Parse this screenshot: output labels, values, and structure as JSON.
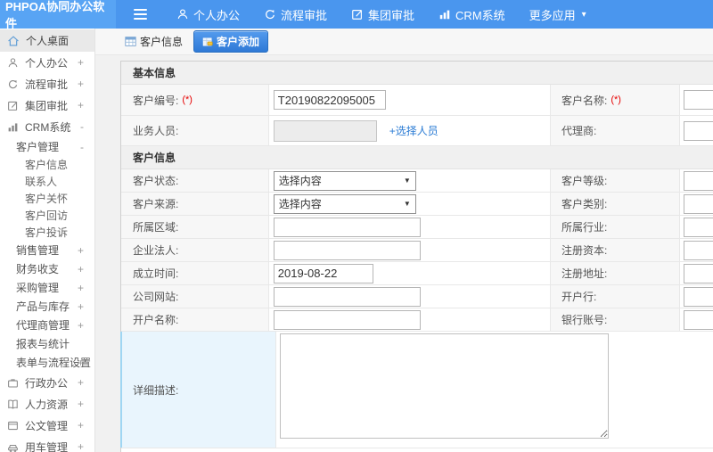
{
  "app": {
    "title": "PHPOA协同办公软件"
  },
  "topnav": {
    "items": [
      {
        "label": "个人办公",
        "icon": "person-icon"
      },
      {
        "label": "流程审批",
        "icon": "process-icon"
      },
      {
        "label": "集团审批",
        "icon": "edit-icon"
      },
      {
        "label": "CRM系统",
        "icon": "chart-icon"
      },
      {
        "label": "更多应用",
        "icon": "caret-down-icon"
      }
    ],
    "caret": "▾"
  },
  "sidebar": {
    "items": [
      {
        "label": "个人桌面",
        "expand": ""
      },
      {
        "label": "个人办公",
        "expand": "+"
      },
      {
        "label": "流程审批",
        "expand": "+"
      },
      {
        "label": "集团审批",
        "expand": "+"
      },
      {
        "label": "CRM系统",
        "expand": "-"
      },
      {
        "label": "客户管理",
        "expand": "-"
      },
      {
        "label": "客户信息",
        "expand": ""
      },
      {
        "label": "联系人",
        "expand": ""
      },
      {
        "label": "客户关怀",
        "expand": ""
      },
      {
        "label": "客户回访",
        "expand": ""
      },
      {
        "label": "客户投诉",
        "expand": ""
      },
      {
        "label": "销售管理",
        "expand": "+"
      },
      {
        "label": "财务收支",
        "expand": "+"
      },
      {
        "label": "采购管理",
        "expand": "+"
      },
      {
        "label": "产品与库存",
        "expand": "+"
      },
      {
        "label": "代理商管理",
        "expand": "+"
      },
      {
        "label": "报表与统计",
        "expand": ""
      },
      {
        "label": "表单与流程设置",
        "expand": "+"
      },
      {
        "label": "行政办公",
        "expand": "+"
      },
      {
        "label": "人力资源",
        "expand": "+"
      },
      {
        "label": "公文管理",
        "expand": "+"
      },
      {
        "label": "用车管理",
        "expand": "+"
      }
    ]
  },
  "tabs": {
    "customer_info": "客户信息",
    "customer_add": "客户添加"
  },
  "form": {
    "section_basic": "基本信息",
    "section_customer": "客户信息",
    "rows": [
      {
        "l1": "客户编号:",
        "req1": "(*)",
        "value": "T20190822095005",
        "l2": "客户名称:",
        "req2": "(*)"
      },
      {
        "l1": "业务人员:",
        "link": "+选择人员",
        "l2": "代理商:"
      },
      {
        "l1": "客户状态:",
        "select": "选择内容",
        "arrow": "▼",
        "l2": "客户等级:"
      },
      {
        "l1": "客户来源:",
        "select": "选择内容",
        "arrow": "▼",
        "l2": "客户类别:"
      },
      {
        "l1": "所属区域:",
        "l2": "所属行业:"
      },
      {
        "l1": "企业法人:",
        "l2": "注册资本:"
      },
      {
        "l1": "成立时间:",
        "value": "2019-08-22",
        "l2": "注册地址:"
      },
      {
        "l1": "公司网站:",
        "l2": "开户行:"
      },
      {
        "l1": "开户名称:",
        "l2": "银行账号:"
      },
      {
        "l1": "详细描述:"
      }
    ]
  }
}
